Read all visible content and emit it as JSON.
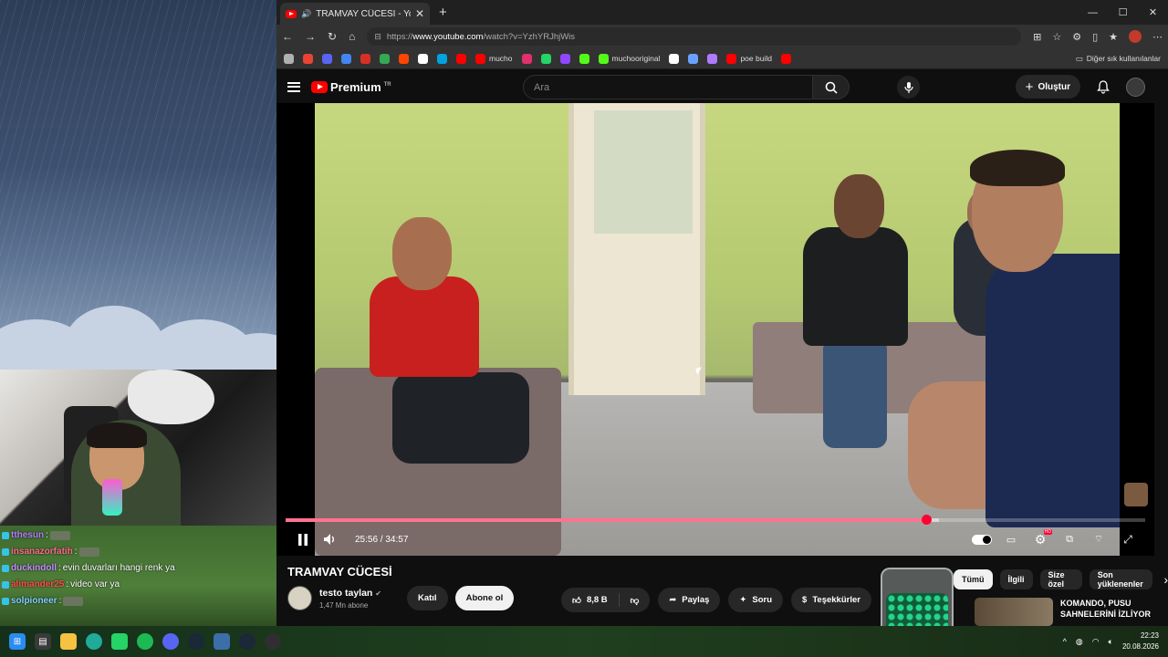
{
  "browser": {
    "tab_title": "TRAMVAY CÜCESİ - YouTube",
    "url_scheme": "https://",
    "url_host": "www.youtube.com",
    "url_path": "/watch?v=YzhYRJhjWis",
    "bookmarks": [
      {
        "label": "",
        "icon": "generic",
        "color": "#b0b0b0"
      },
      {
        "label": "",
        "icon": "gmail",
        "color": "#ea4335"
      },
      {
        "label": "",
        "icon": "discord",
        "color": "#5865f2"
      },
      {
        "label": "",
        "icon": "translate",
        "color": "#4285f4"
      },
      {
        "label": "",
        "icon": "mail",
        "color": "#d93025"
      },
      {
        "label": "",
        "icon": "google",
        "color": "#34a853"
      },
      {
        "label": "",
        "icon": "reddit",
        "color": "#ff4500"
      },
      {
        "label": "",
        "icon": "x",
        "color": "#ffffff"
      },
      {
        "label": "",
        "icon": "generic",
        "color": "#00a3e0"
      },
      {
        "label": "",
        "icon": "youtube",
        "color": "#ff0000"
      },
      {
        "label": "mucho",
        "icon": "youtube",
        "color": "#ff0000"
      },
      {
        "label": "",
        "icon": "instagram",
        "color": "#e1306c"
      },
      {
        "label": "",
        "icon": "whatsapp",
        "color": "#25d366"
      },
      {
        "label": "",
        "icon": "twitch",
        "color": "#9146ff"
      },
      {
        "label": "",
        "icon": "generic",
        "color": "#53fc18"
      },
      {
        "label": "muchooriginal",
        "icon": "kick",
        "color": "#53fc18"
      },
      {
        "label": "",
        "icon": "chatgpt",
        "color": "#ffffff"
      },
      {
        "label": "",
        "icon": "generic",
        "color": "#6aa0ff"
      },
      {
        "label": "",
        "icon": "generic",
        "color": "#b07aff"
      },
      {
        "label": "poe build",
        "icon": "youtube",
        "color": "#ff0000"
      },
      {
        "label": "",
        "icon": "youtube",
        "color": "#ff0000"
      }
    ],
    "other_bookmarks": "Diğer sık kullanılanlar"
  },
  "youtube": {
    "logo": "Premium",
    "logo_region": "TR",
    "search_placeholder": "Ara",
    "create_label": "Oluştur",
    "accent": "#ff0033"
  },
  "player": {
    "current_time": "25:56",
    "total_time": "34:57",
    "time_sep": " / ",
    "progress": 0.745,
    "buffered": 0.76
  },
  "video": {
    "title": "TRAMVAY CÜCESİ",
    "channel_name": "testo taylan",
    "verified": "✔",
    "subscribers": "1,47 Mn abone",
    "join_label": "Katıl",
    "subscribe_label": "Abone ol",
    "likes": "8,8 B",
    "share_label": "Paylaş",
    "ask_label": "Soru",
    "thanks_label": "Teşekkürler"
  },
  "sidebar": {
    "chips": [
      "Tümü",
      "İlgili",
      "Size özel",
      "Son yüklenenler"
    ],
    "rec_title": "KOMANDO, PUSU SAHNELERİNİ İZLİYOR"
  },
  "chat": [
    {
      "user": "tthesun",
      "message": "",
      "color": "#b77cff",
      "emote": true
    },
    {
      "user": "insanazorfatih",
      "message": "",
      "color": "#ff6b8a",
      "emote": true
    },
    {
      "user": "duckindoll",
      "message": "evin duvarları hangi renk ya",
      "color": "#c48bff",
      "emote": false
    },
    {
      "user": "alimander25",
      "message": "video var ya",
      "color": "#ff4d4d",
      "emote": false
    },
    {
      "user": "solpioneer",
      "message": "",
      "color": "#7fd1ff",
      "emote": true
    }
  ],
  "taskbar": {
    "time": "22:23",
    "date": "20.08.2026"
  }
}
